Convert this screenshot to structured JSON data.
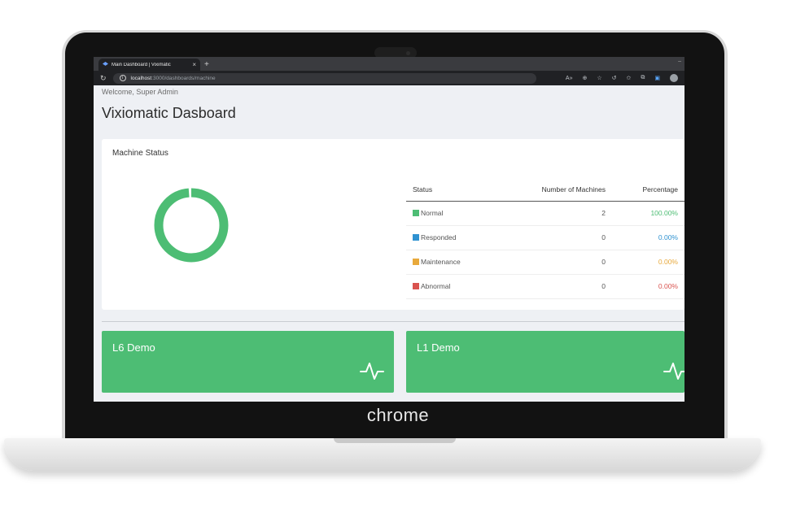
{
  "browser": {
    "tab_title": "Main Dashboard | Viximatic",
    "tab_close": "×",
    "new_tab": "+",
    "url_host": "localhost",
    "url_path": ":3000/dashboards/machine"
  },
  "laptop": {
    "brand": "chrome"
  },
  "header": {
    "welcome": "Welcome, Super Admin",
    "title": "Vixiomatic Dasboard"
  },
  "machine_status": {
    "title": "Machine Status",
    "columns": [
      "Status",
      "Number of Machines",
      "Percentage"
    ],
    "rows": [
      {
        "label": "Normal",
        "count": "2",
        "percentage": "100.00%",
        "color": "#4dbd74"
      },
      {
        "label": "Responded",
        "count": "0",
        "percentage": "0.00%",
        "color": "#2f92d1"
      },
      {
        "label": "Maintenance",
        "count": "0",
        "percentage": "0.00%",
        "color": "#e8a93c"
      },
      {
        "label": "Abnormal",
        "count": "0",
        "percentage": "0.00%",
        "color": "#d9534f"
      }
    ],
    "donut_fraction_normal": 1.0
  },
  "lines": [
    {
      "name": "L6 Demo",
      "icon": "activity-icon"
    },
    {
      "name": "L1 Demo",
      "icon": "activity-icon"
    }
  ],
  "colors": {
    "tile": "#4dbd74",
    "normal": "#4dbd74"
  }
}
